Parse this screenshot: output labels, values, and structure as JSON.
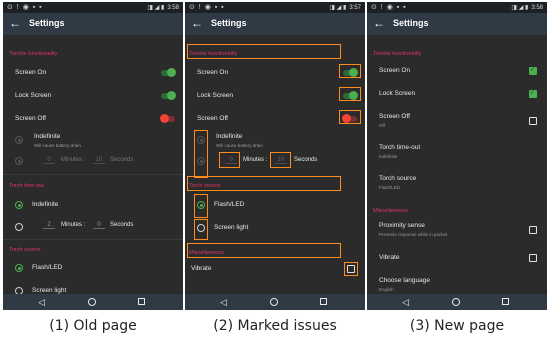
{
  "status_bar": {
    "left_icons": "⊙ ! ◉ ▪ ▪",
    "right_icons": "◨ ◢ ▮",
    "times": [
      "3:58",
      "3:57",
      "3:58"
    ]
  },
  "app_bar": {
    "title": "Settings"
  },
  "old_page": {
    "sections": {
      "torchie": "Torchie functionality",
      "timeout": "Torch time-out",
      "source": "Torch source"
    },
    "screen_on": "Screen On",
    "lock_screen": "Lock Screen",
    "screen_off": "Screen Off",
    "indefinite_label": "Indefinite",
    "indefinite_sub": "Will cause battery drain",
    "minutes_value": "0",
    "minutes_unit": "Minutes :",
    "seconds_value": "10",
    "seconds_unit": "Seconds",
    "timeout_indefinite": "Indefinite",
    "timeout_minutes_value": "2",
    "timeout_seconds_value": "0",
    "flash_led": "Flash/LED",
    "screen_light": "Screen light"
  },
  "marked_page": {
    "sections": {
      "torchie": "Torchie functionality",
      "source": "Torch source",
      "misc": "Miscellaneous"
    },
    "screen_on": "Screen On",
    "lock_screen": "Lock Screen",
    "screen_off": "Screen Off",
    "indefinite_label": "Indefinite",
    "indefinite_sub": "Will cause battery drain",
    "minutes_value": "0",
    "minutes_unit": "Minutes :",
    "seconds_value": "10",
    "seconds_unit": "Seconds",
    "flash_led": "Flash/LED",
    "screen_light": "Screen light",
    "vibrate": "Vibrate"
  },
  "new_page": {
    "sections": {
      "torchie": "Torchie functionality",
      "misc": "Miscellaneous"
    },
    "screen_on": "Screen On",
    "lock_screen": "Lock Screen",
    "screen_off": "Screen Off",
    "screen_off_sub": "Off",
    "timeout": "Torch time-out",
    "timeout_sub": "Indefinite",
    "source": "Torch source",
    "source_sub": "Flash/LED",
    "proximity": "Proximity sense",
    "proximity_sub": "Prevents response while in pocket",
    "vibrate": "Vibrate",
    "language": "Choose language",
    "language_sub": "English"
  },
  "captions": [
    "(1) Old page",
    "(2) Marked issues",
    "(3) New page"
  ],
  "colors": {
    "accent_pink": "#e0336b",
    "switch_green": "#4caf50",
    "switch_red": "#f44336",
    "mark_orange": "#ff8c1a",
    "app_bar": "#2f3a45"
  }
}
